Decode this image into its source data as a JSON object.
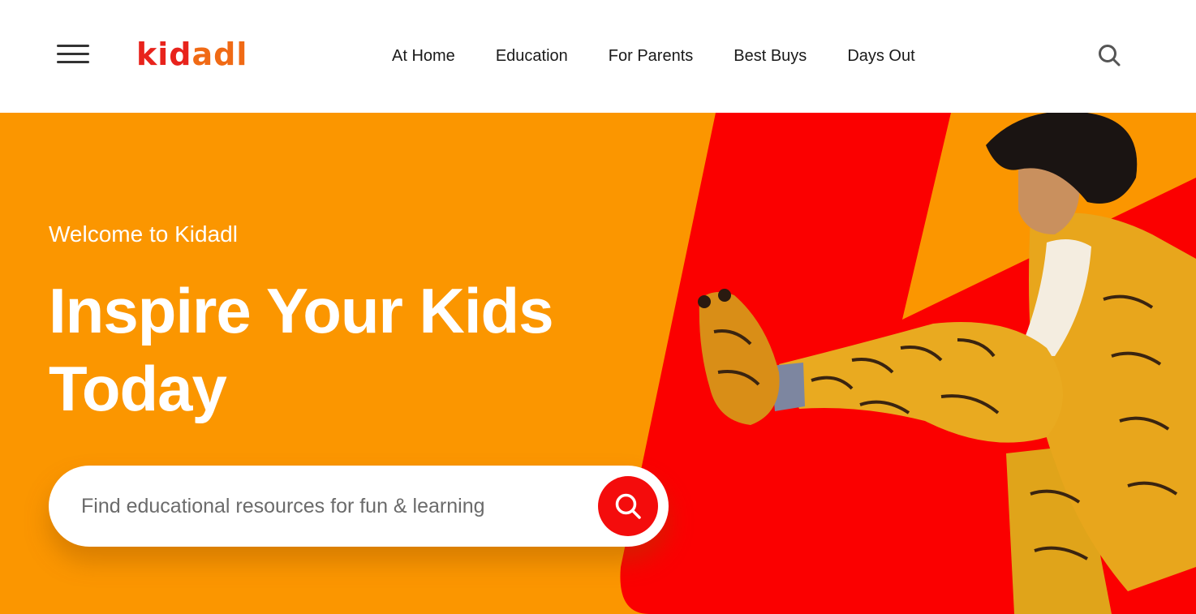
{
  "header": {
    "logo_part1": "kid",
    "logo_part2": "adl",
    "nav": [
      "At Home",
      "Education",
      "For Parents",
      "Best Buys",
      "Days Out"
    ]
  },
  "hero": {
    "welcome": "Welcome to Kidadl",
    "headline_line1": "Inspire Your Kids",
    "headline_line2": "Today",
    "search_placeholder": "Find educational resources for fun & learning"
  },
  "icons": {
    "menu": "hamburger-menu-icon",
    "search": "search-icon"
  },
  "colors": {
    "brand_red": "#f40c0c",
    "brand_orange": "#fb9600",
    "logo_orange": "#f06a15"
  }
}
